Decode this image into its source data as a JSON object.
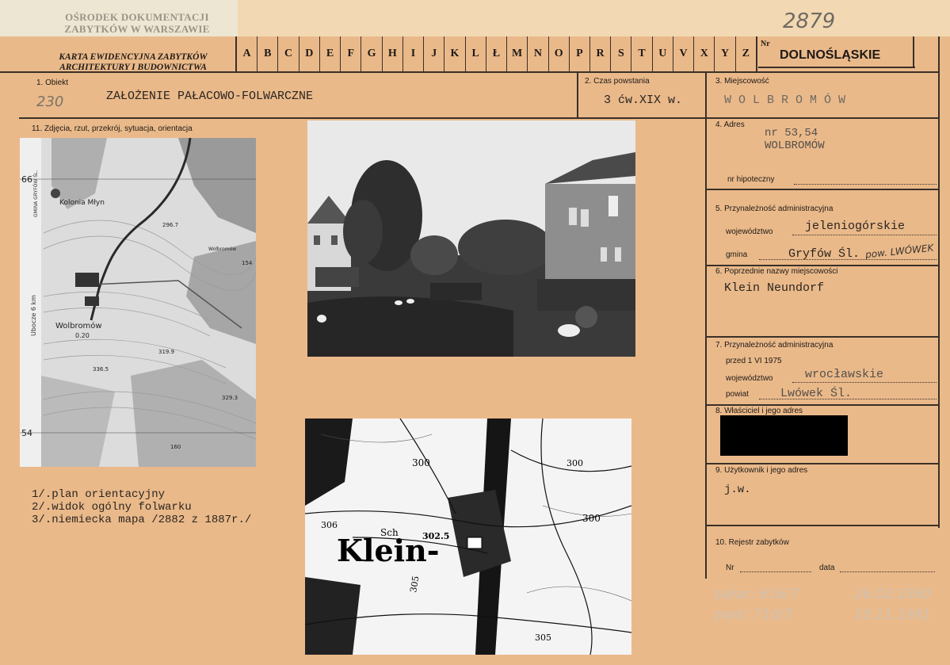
{
  "stamp": "OŚRODEK DOKUMENTACJI ZABYTKÓW W WARSZAWIE",
  "card_number": "2879",
  "header_title": [
    "KARTA EWIDENCYJNA ZABYTKÓW",
    "ARCHITEKTURY I BUDOWNICTWA"
  ],
  "letters": [
    "A",
    "B",
    "C",
    "D",
    "E",
    "F",
    "G",
    "H",
    "I",
    "J",
    "K",
    "L",
    "Ł",
    "M",
    "N",
    "O",
    "P",
    "R",
    "S",
    "T",
    "U",
    "V",
    "X",
    "Y",
    "Z"
  ],
  "nr_label": "Nr",
  "province": "DOLNOŚLĄSKIE",
  "field1": {
    "label": "1. Obiekt",
    "number": "230",
    "value": "ZAŁOŻENIE PAŁACOWO-FOLWARCZNE"
  },
  "field2": {
    "label": "2. Czas powstania",
    "value": "3 ćw.XIX w."
  },
  "field3": {
    "label": "3. Miejscowość",
    "value": "W O L B R O M Ó W"
  },
  "field11": {
    "label": "11. Zdjęcia, rzut, przekrój, sytuacja, orientacja"
  },
  "field4": {
    "label": "4. Adres",
    "value_line1": "nr 53,54",
    "value_line2": "WOLBROMÓW",
    "hipoteczny_label": "nr hipoteczny"
  },
  "field5": {
    "label": "5. Przynależność administracyjna",
    "woj_label": "województwo",
    "woj_value": "jeleniogórskie",
    "gmina_label": "gmina",
    "gmina_value": "Gryfów Śl.",
    "gmina_hand": "pow. LWÓWEK"
  },
  "field6": {
    "label": "6. Poprzednie nazwy miejscowości",
    "value": "Klein Neundorf"
  },
  "field7": {
    "label": "7. Przynależność administracyjna",
    "date_label": "przed 1 VI 1975",
    "woj_label": "województwo",
    "woj_value": "wrocławskie",
    "powiat_label": "powiat",
    "powiat_value": "Lwówek Śl."
  },
  "field8": {
    "label": "8. Właściciel i jego adres"
  },
  "field9": {
    "label": "9. Użytkownik i jego adres",
    "value": "j.w."
  },
  "field10": {
    "label": "10. Rejestr zabytków",
    "nr_label": "Nr",
    "data_label": "data"
  },
  "captions": [
    "1/.plan orientacyjny",
    "2/.widok ogólny folwarku",
    "3/.niemiecka mapa /2882 z 1887r./"
  ],
  "notes": [
    {
      "label": "pałac: 616/7",
      "date": "26.02.1980"
    },
    {
      "label": "park: 710/7",
      "date": "10.11.1981"
    }
  ],
  "map1": {
    "labels": [
      "66",
      "54",
      "Kolonia Młyn",
      "Wolbromów",
      "Wolbromów",
      "0.20",
      "GMINA GRYFÓW ŚL.",
      "Ubocze 6 km",
      "296.7",
      "154",
      "319.9",
      "336.5",
      "329.3",
      "160"
    ]
  },
  "map2": {
    "labels": [
      "Klein-",
      "Sch",
      "302.5",
      "300",
      "300",
      "306",
      "305",
      "300",
      "305"
    ]
  },
  "colors": {
    "paper": "#eab98a",
    "ink": "#1e1a16",
    "redaction": "#000000"
  }
}
